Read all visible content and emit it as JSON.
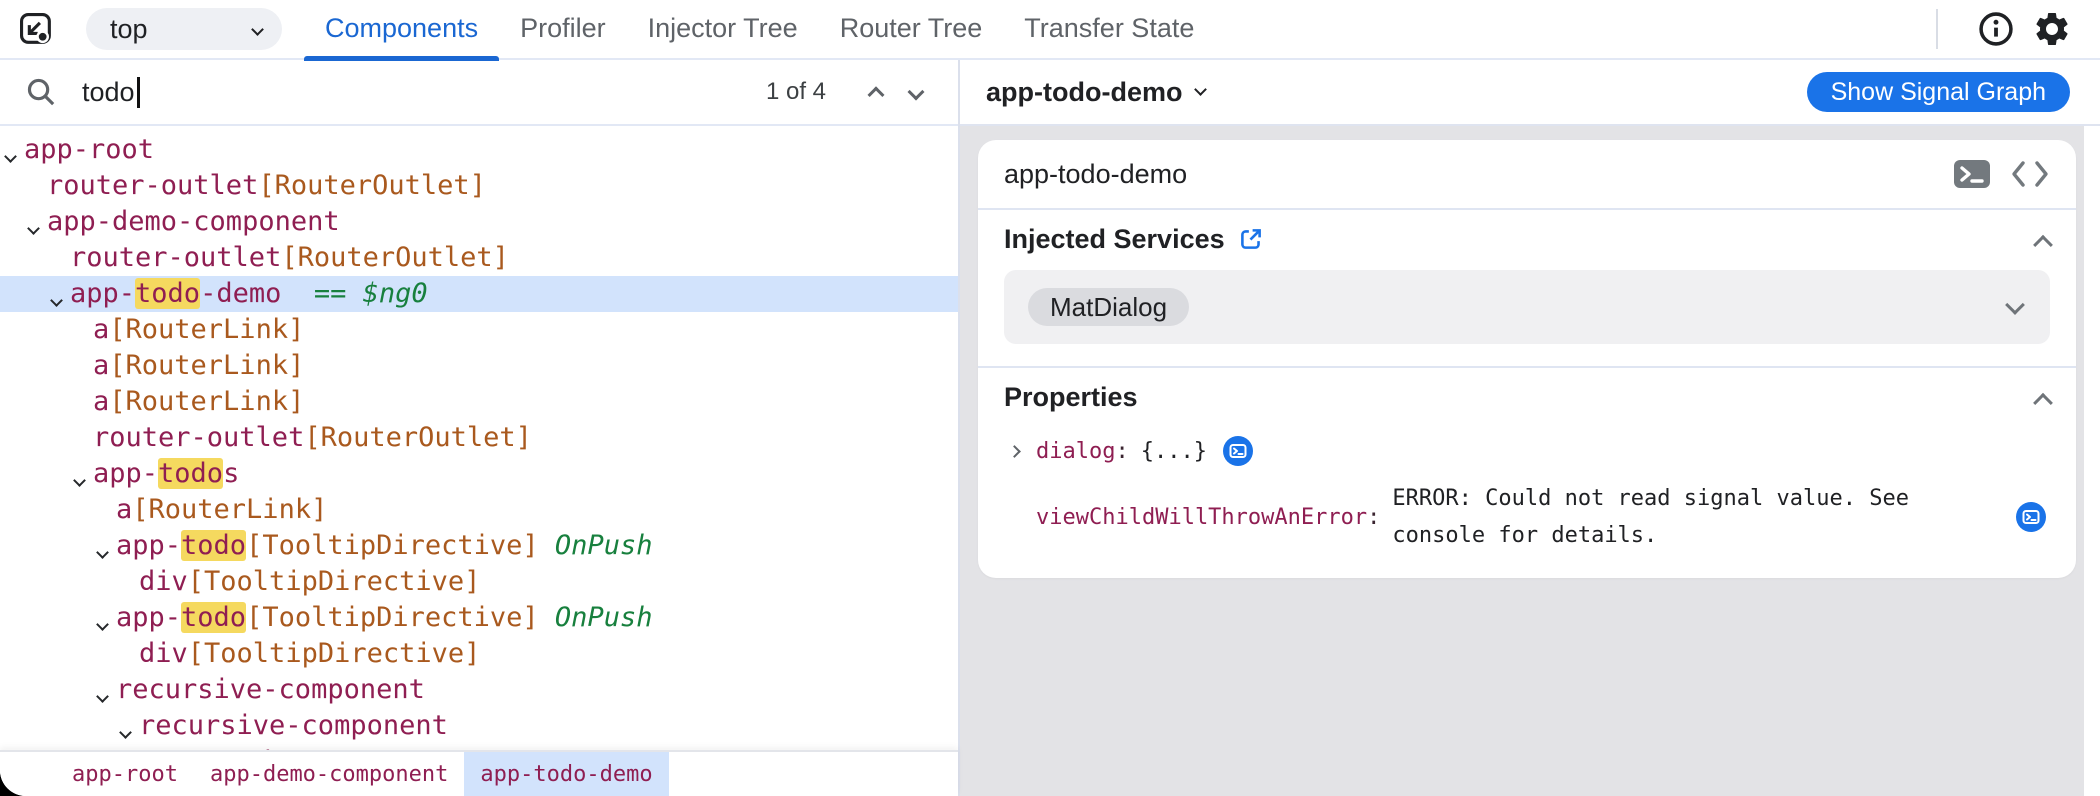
{
  "topbar": {
    "frame": "top",
    "frame_icon": "chevron-down-icon",
    "inspect_icon": "inspect-element-icon",
    "tabs": [
      {
        "label": "Components",
        "active": true
      },
      {
        "label": "Profiler",
        "active": false
      },
      {
        "label": "Injector Tree",
        "active": false
      },
      {
        "label": "Router Tree",
        "active": false
      },
      {
        "label": "Transfer State",
        "active": false
      }
    ],
    "right_icons": [
      "info-icon",
      "gear-icon"
    ]
  },
  "search": {
    "icon": "search-icon",
    "value": "todo",
    "count": "1 of 4",
    "nav_icons": [
      "chevron-up-icon",
      "chevron-down-icon"
    ]
  },
  "colors": {
    "accent_blue": "#1a73e8",
    "tab_blue": "#1a67d2",
    "selection_blue": "#d2e3fc",
    "tag_maroon": "#8f1e52",
    "directive_orange": "#a9591e",
    "meta_green": "#18803e",
    "highlight_yellow": "#f5d95f"
  },
  "tree": {
    "rows": [
      {
        "depth": 0,
        "chevron": true,
        "selected": false,
        "segments": [
          {
            "t": "app-root",
            "c": "tag"
          }
        ]
      },
      {
        "depth": 1,
        "chevron": false,
        "selected": false,
        "segments": [
          {
            "t": "router-outlet",
            "c": "tag"
          },
          {
            "t": "[RouterOutlet]",
            "c": "dir"
          }
        ]
      },
      {
        "depth": 1,
        "chevron": true,
        "selected": false,
        "segments": [
          {
            "t": "app-demo-component",
            "c": "tag"
          }
        ]
      },
      {
        "depth": 2,
        "chevron": false,
        "selected": false,
        "segments": [
          {
            "t": "router-outlet",
            "c": "tag"
          },
          {
            "t": "[RouterOutlet]",
            "c": "dir"
          }
        ]
      },
      {
        "depth": 2,
        "chevron": true,
        "selected": true,
        "segments": [
          {
            "t": "app-",
            "c": "tag"
          },
          {
            "t": "todo",
            "c": "tag hl"
          },
          {
            "t": "-demo",
            "c": "tag"
          },
          {
            "t": "  == ",
            "c": "eq"
          },
          {
            "t": "$ng0",
            "c": "ref"
          }
        ]
      },
      {
        "depth": 3,
        "chevron": false,
        "selected": false,
        "segments": [
          {
            "t": "a",
            "c": "tag"
          },
          {
            "t": "[RouterLink]",
            "c": "dir"
          }
        ]
      },
      {
        "depth": 3,
        "chevron": false,
        "selected": false,
        "segments": [
          {
            "t": "a",
            "c": "tag"
          },
          {
            "t": "[RouterLink]",
            "c": "dir"
          }
        ]
      },
      {
        "depth": 3,
        "chevron": false,
        "selected": false,
        "segments": [
          {
            "t": "a",
            "c": "tag"
          },
          {
            "t": "[RouterLink]",
            "c": "dir"
          }
        ]
      },
      {
        "depth": 3,
        "chevron": false,
        "selected": false,
        "segments": [
          {
            "t": "router-outlet",
            "c": "tag"
          },
          {
            "t": "[RouterOutlet]",
            "c": "dir"
          }
        ]
      },
      {
        "depth": 3,
        "chevron": true,
        "selected": false,
        "segments": [
          {
            "t": "app-",
            "c": "tag"
          },
          {
            "t": "todo",
            "c": "tag hl"
          },
          {
            "t": "s",
            "c": "tag"
          }
        ]
      },
      {
        "depth": 4,
        "chevron": false,
        "selected": false,
        "segments": [
          {
            "t": "a",
            "c": "tag"
          },
          {
            "t": "[RouterLink]",
            "c": "dir"
          }
        ]
      },
      {
        "depth": 4,
        "chevron": true,
        "selected": false,
        "segments": [
          {
            "t": "app-",
            "c": "tag"
          },
          {
            "t": "todo",
            "c": "tag hl"
          },
          {
            "t": "[TooltipDirective]",
            "c": "dir"
          },
          {
            "t": " OnPush",
            "c": "mod"
          }
        ]
      },
      {
        "depth": 5,
        "chevron": false,
        "selected": false,
        "segments": [
          {
            "t": "div",
            "c": "tag"
          },
          {
            "t": "[TooltipDirective]",
            "c": "dir"
          }
        ]
      },
      {
        "depth": 4,
        "chevron": true,
        "selected": false,
        "segments": [
          {
            "t": "app-",
            "c": "tag"
          },
          {
            "t": "todo",
            "c": "tag hl"
          },
          {
            "t": "[TooltipDirective]",
            "c": "dir"
          },
          {
            "t": " OnPush",
            "c": "mod"
          }
        ]
      },
      {
        "depth": 5,
        "chevron": false,
        "selected": false,
        "segments": [
          {
            "t": "div",
            "c": "tag"
          },
          {
            "t": "[TooltipDirective]",
            "c": "dir"
          }
        ]
      },
      {
        "depth": 4,
        "chevron": true,
        "selected": false,
        "segments": [
          {
            "t": "recursive-component",
            "c": "tag"
          }
        ]
      },
      {
        "depth": 5,
        "chevron": true,
        "selected": false,
        "segments": [
          {
            "t": "recursive-component",
            "c": "tag"
          }
        ]
      },
      {
        "depth": 6,
        "chevron": true,
        "selected": false,
        "segments": [
          {
            "t": "recursive-component",
            "c": "tag"
          }
        ]
      }
    ]
  },
  "breadcrumbs": [
    {
      "label": "app-root",
      "selected": false
    },
    {
      "label": "app-demo-component",
      "selected": false
    },
    {
      "label": "app-todo-demo",
      "selected": true
    }
  ],
  "details": {
    "header": {
      "title": "app-todo-demo",
      "title_icon": "chevron-down-icon",
      "button_label": "Show Signal Graph"
    },
    "card": {
      "title": "app-todo-demo",
      "header_icons": [
        "terminal-icon",
        "code-icon"
      ],
      "injected": {
        "title": "Injected Services",
        "title_icon": "external-link-icon",
        "collapse_icon": "chevron-up-icon",
        "services": [
          "MatDialog"
        ],
        "box_icon": "chevron-down-icon"
      },
      "properties": {
        "title": "Properties",
        "collapse_icon": "chevron-up-icon",
        "rows": [
          {
            "name": "dialog",
            "colon": ":",
            "value": "{...}",
            "expandable": true,
            "icon": "terminal-circle-icon",
            "layout": "inline"
          },
          {
            "name": "viewChildWillThrowAnError",
            "colon": ":",
            "value": "ERROR: Could not read signal value. See console for details.",
            "expandable": false,
            "icon": "terminal-circle-icon",
            "layout": "block"
          }
        ]
      }
    }
  }
}
